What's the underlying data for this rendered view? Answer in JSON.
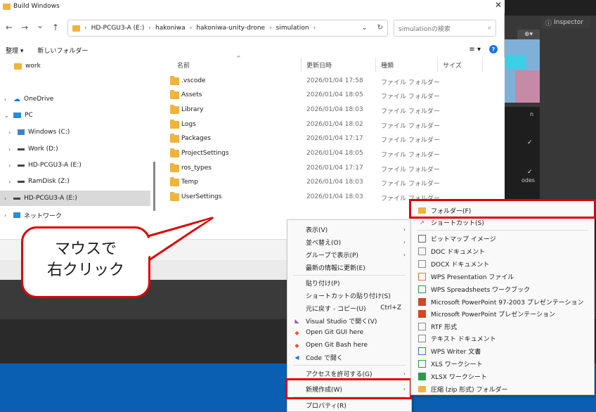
{
  "window": {
    "title": "Build Windows",
    "close": "✕"
  },
  "nav": {
    "back": "←",
    "forward": "→",
    "dropdown": "⌄",
    "up": "↑"
  },
  "address": {
    "crumbs": [
      "HD-PCGU3-A (E:)",
      "hakoniwa",
      "hakoniwa-unity-drone",
      "simulation"
    ],
    "dropdown": "⌄",
    "refresh": "↻"
  },
  "search": {
    "placeholder": "simulationの検索",
    "icon": "⌕"
  },
  "toolbar": {
    "organize": "整理 ▾",
    "new_folder": "新しいフォルダー",
    "view": "≡ ▾",
    "help": "?"
  },
  "sidebar": {
    "items": [
      {
        "label": "work",
        "icon": "folder-icon"
      },
      {
        "label": "OneDrive",
        "icon": "cloud-icon"
      },
      {
        "label": "PC",
        "icon": "monitor-icon"
      },
      {
        "label": "Windows (C:)",
        "icon": "windows-icon"
      },
      {
        "label": "Work (D:)",
        "icon": "drive-icon"
      },
      {
        "label": "HD-PCGU3-A (E:)",
        "icon": "drive-icon"
      },
      {
        "label": "RamDisk (Z:)",
        "icon": "drive-icon"
      },
      {
        "label": "HD-PCGU3-A (E:)",
        "icon": "drive-icon"
      },
      {
        "label": "ネットワーク",
        "icon": "network-icon"
      }
    ]
  },
  "columns": {
    "name": "名前",
    "date": "更新日時",
    "type": "種類",
    "size": "サイズ"
  },
  "files": [
    {
      "name": ".vscode",
      "date": "2026/01/04 17:58",
      "type": "ファイル フォルダー"
    },
    {
      "name": "Assets",
      "date": "2026/01/04 18:05",
      "type": "ファイル フォルダー"
    },
    {
      "name": "Library",
      "date": "2026/01/04 18:03",
      "type": "ファイル フォルダー"
    },
    {
      "name": "Logs",
      "date": "2026/01/04 18:02",
      "type": "ファイル フォルダー"
    },
    {
      "name": "Packages",
      "date": "2026/01/04 17:17",
      "type": "ファイル フォルダー"
    },
    {
      "name": "ProjectSettings",
      "date": "2026/01/04 18:05",
      "type": "ファイル フォルダー"
    },
    {
      "name": "ros_types",
      "date": "2026/01/04 17:17",
      "type": "ファイル フォルダー"
    },
    {
      "name": "Temp",
      "date": "2026/01/04 18:03",
      "type": "ファイル フォルダー"
    },
    {
      "name": "UserSettings",
      "date": "2026/01/04 18:03",
      "type": "ファイル フォルダー"
    }
  ],
  "context_menu": {
    "items": [
      {
        "label": "表示(V)"
      },
      {
        "label": "並べ替え(O)"
      },
      {
        "label": "グループで表示(P)"
      },
      {
        "label": "最新の情報に更新(E)"
      },
      {
        "label": "貼り付け(P)"
      },
      {
        "label": "ショートカットの貼り付け(S)"
      },
      {
        "label": "元に戻す - コピー(U)",
        "shortcut": "Ctrl+Z"
      },
      {
        "label": "Visual Studio で開く(V)"
      },
      {
        "label": "Open Git GUI here"
      },
      {
        "label": "Open Git Bash here"
      },
      {
        "label": "Code で開く"
      },
      {
        "label": "アクセスを許可する(G)"
      },
      {
        "label": "新規作成(W)"
      },
      {
        "label": "プロパティ(R)"
      }
    ]
  },
  "submenu": {
    "items": [
      {
        "label": "フォルダー(F)"
      },
      {
        "label": "ショートカット(S)"
      },
      {
        "label": "ビットマップ イメージ"
      },
      {
        "label": "DOC ドキュメント"
      },
      {
        "label": "DOCX ドキュメント"
      },
      {
        "label": "WPS Presentation ファイル"
      },
      {
        "label": "WPS Spreadsheets ワークブック"
      },
      {
        "label": "Microsoft PowerPoint 97-2003 プレゼンテーション"
      },
      {
        "label": "Microsoft PowerPoint プレゼンテーション"
      },
      {
        "label": "RTF 形式"
      },
      {
        "label": "テキスト ドキュメント"
      },
      {
        "label": "WPS Writer 文書"
      },
      {
        "label": "XLS ワークシート"
      },
      {
        "label": "XLSX ワークシート"
      },
      {
        "label": "圧縮 (zip 形式) フォルダー"
      }
    ]
  },
  "callout": {
    "line1": "マウスで",
    "line2": "右クリック"
  },
  "unity": {
    "inspector": "Inspector",
    "label1": "n",
    "label2": "odes"
  },
  "colors": {
    "highlight_red": "#e00000",
    "folder": "#f0b43c",
    "accent_blue": "#1a73e8"
  }
}
